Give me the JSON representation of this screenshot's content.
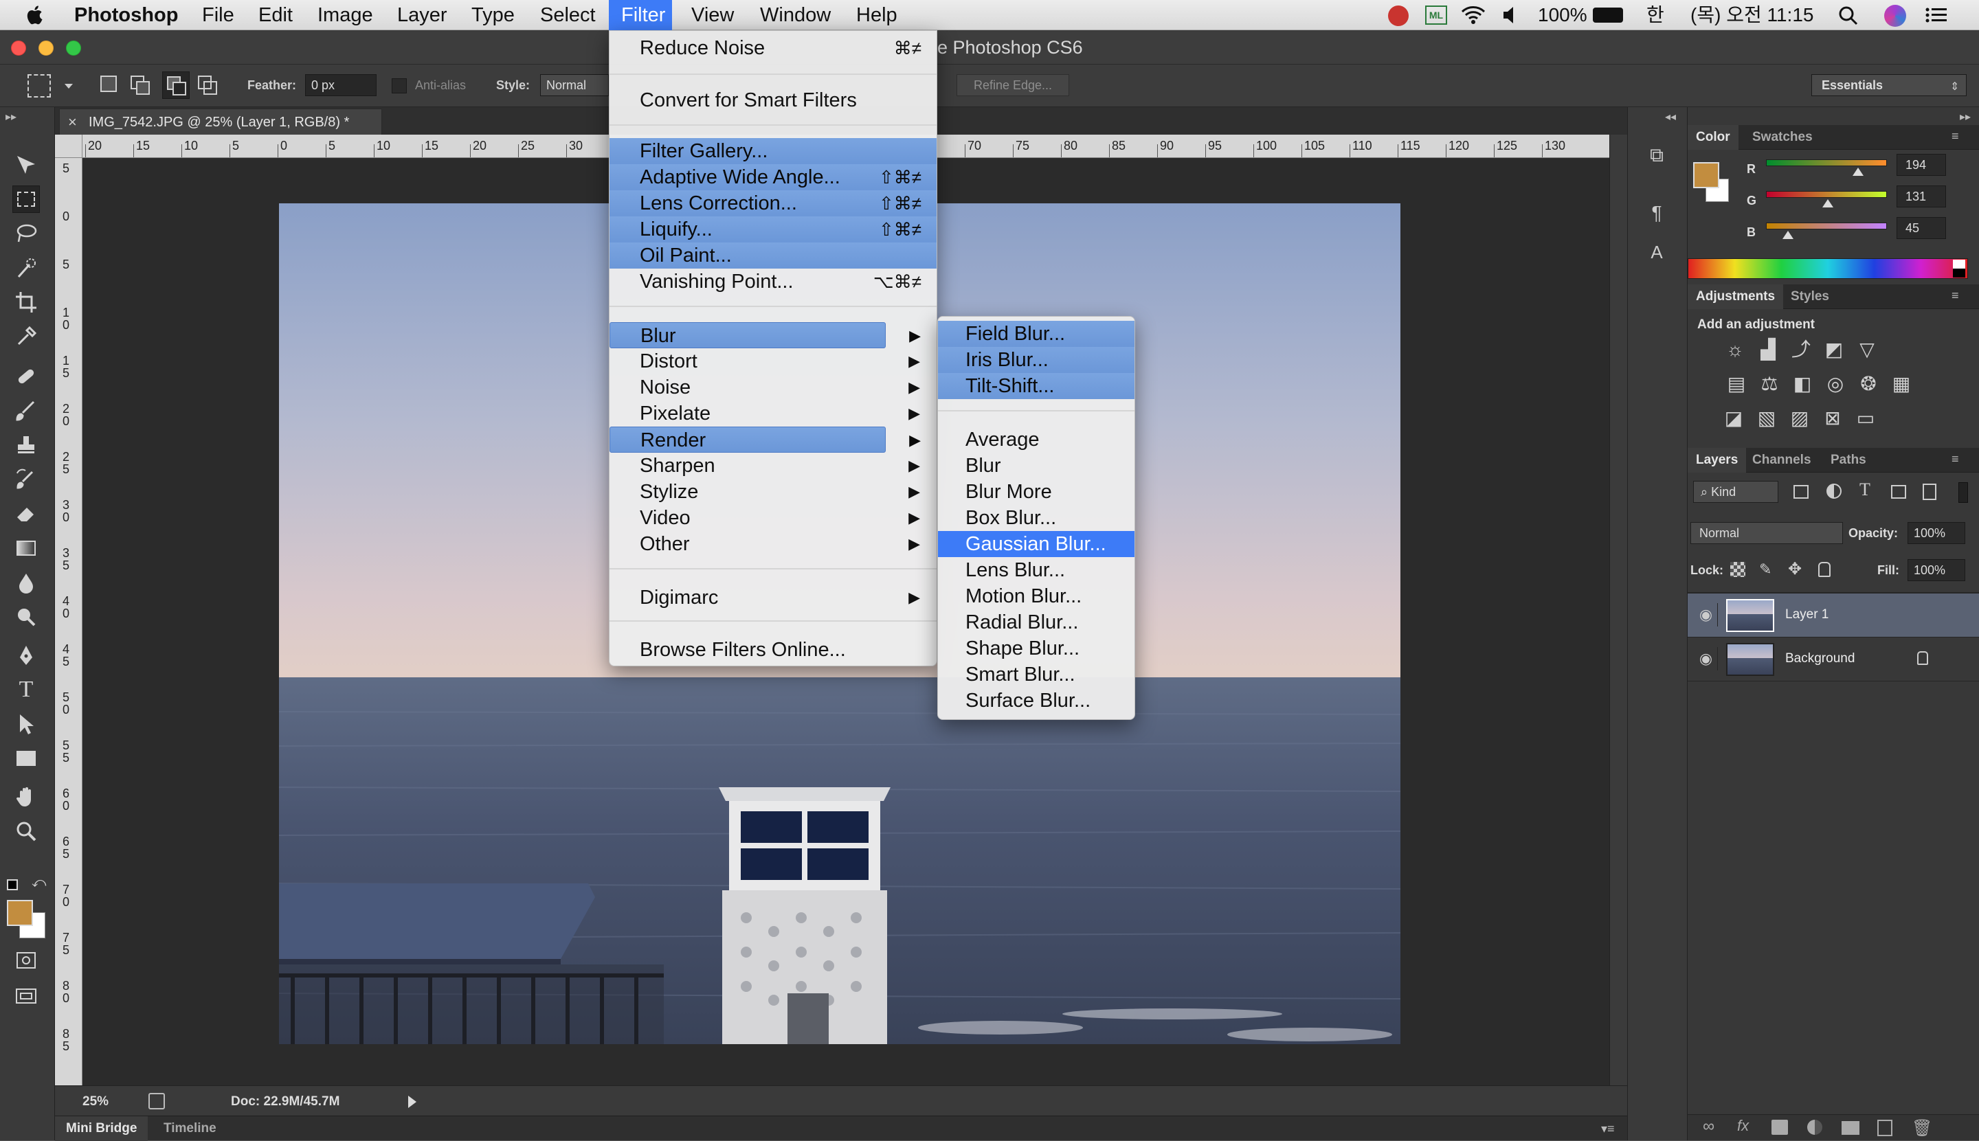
{
  "menubar": {
    "apple_icon": "apple-logo",
    "items": [
      "Photoshop",
      "File",
      "Edit",
      "Image",
      "Layer",
      "Type",
      "Select",
      "Filter",
      "View",
      "Window",
      "Help"
    ],
    "active": "Filter",
    "status": {
      "battery": "100%",
      "input_method": "한",
      "clock": "(목) 오전 11:15",
      "ml_badge": "ML"
    }
  },
  "window": {
    "title": "e Photoshop CS6"
  },
  "options_bar": {
    "feather_label": "Feather:",
    "feather_value": "0 px",
    "antialias_label": "Anti-alias",
    "style_label": "Style:",
    "style_value": "Normal",
    "refine_edge": "Refine Edge...",
    "workspace": "Essentials"
  },
  "document": {
    "tab_title": "IMG_7542.JPG @ 25% (Layer 1, RGB/8) *",
    "close_glyph": "×",
    "ruler_top_labels": [
      "20",
      "15",
      "10",
      "5",
      "0",
      "5",
      "10",
      "15",
      "20",
      "25",
      "30",
      "70",
      "75",
      "80",
      "85",
      "90",
      "95",
      "100",
      "105",
      "110",
      "115",
      "120",
      "125",
      "130"
    ],
    "ruler_left_labels": [
      "5",
      "0",
      "5",
      "1 0",
      "1 5",
      "2 0",
      "2 5",
      "3 0",
      "3 5",
      "4 0",
      "4 5",
      "5 0",
      "5 5",
      "6 0",
      "6 5",
      "7 0",
      "7 5",
      "8 0",
      "8 5"
    ]
  },
  "status_bar": {
    "zoom": "25%",
    "doc": "Doc: 22.9M/45.7M",
    "tabs": [
      "Mini Bridge",
      "Timeline"
    ]
  },
  "filter_menu": {
    "items": [
      {
        "label": "Reduce Noise",
        "shortcut": "⌘≠"
      },
      {
        "label": "Convert for Smart Filters"
      },
      {
        "label": "Filter Gallery..."
      },
      {
        "label": "Adaptive Wide Angle...",
        "shortcut": "⇧⌘≠"
      },
      {
        "label": "Lens Correction...",
        "shortcut": "⇧⌘≠"
      },
      {
        "label": "Liquify...",
        "shortcut": "⇧⌘≠"
      },
      {
        "label": "Oil Paint..."
      },
      {
        "label": "Vanishing Point...",
        "shortcut": "⌥⌘≠"
      },
      {
        "label": "Blur",
        "arrow": "▶"
      },
      {
        "label": "Distort",
        "arrow": "▶"
      },
      {
        "label": "Noise",
        "arrow": "▶"
      },
      {
        "label": "Pixelate",
        "arrow": "▶"
      },
      {
        "label": "Render",
        "arrow": "▶"
      },
      {
        "label": "Sharpen",
        "arrow": "▶"
      },
      {
        "label": "Stylize",
        "arrow": "▶"
      },
      {
        "label": "Video",
        "arrow": "▶"
      },
      {
        "label": "Other",
        "arrow": "▶"
      },
      {
        "label": "Digimarc",
        "arrow": "▶"
      },
      {
        "label": "Browse Filters Online..."
      }
    ]
  },
  "blur_submenu": {
    "items": [
      "Field Blur...",
      "Iris Blur...",
      "Tilt-Shift...",
      "Average",
      "Blur",
      "Blur More",
      "Box Blur...",
      "Gaussian Blur...",
      "Lens Blur...",
      "Motion Blur...",
      "Radial Blur...",
      "Shape Blur...",
      "Smart Blur...",
      "Surface Blur..."
    ],
    "selected": "Gaussian Blur..."
  },
  "color_panel": {
    "tabs": [
      "Color",
      "Swatches"
    ],
    "channels": [
      {
        "name": "R",
        "value": "194",
        "level": 0.76
      },
      {
        "name": "G",
        "value": "131",
        "level": 0.51
      },
      {
        "name": "B",
        "value": "45",
        "level": 0.18
      }
    ],
    "foreground": "#c28d3f",
    "background": "#ffffff"
  },
  "adjustments_panel": {
    "tabs": [
      "Adjustments",
      "Styles"
    ],
    "heading": "Add an adjustment"
  },
  "layers_panel": {
    "tabs": [
      "Layers",
      "Channels",
      "Paths"
    ],
    "kind_label": "Kind",
    "blend_mode": "Normal",
    "opacity_label": "Opacity:",
    "opacity_value": "100%",
    "lock_label": "Lock:",
    "fill_label": "Fill:",
    "fill_value": "100%",
    "layers": [
      {
        "name": "Layer 1",
        "selected": true
      },
      {
        "name": "Background",
        "locked": true
      }
    ]
  }
}
